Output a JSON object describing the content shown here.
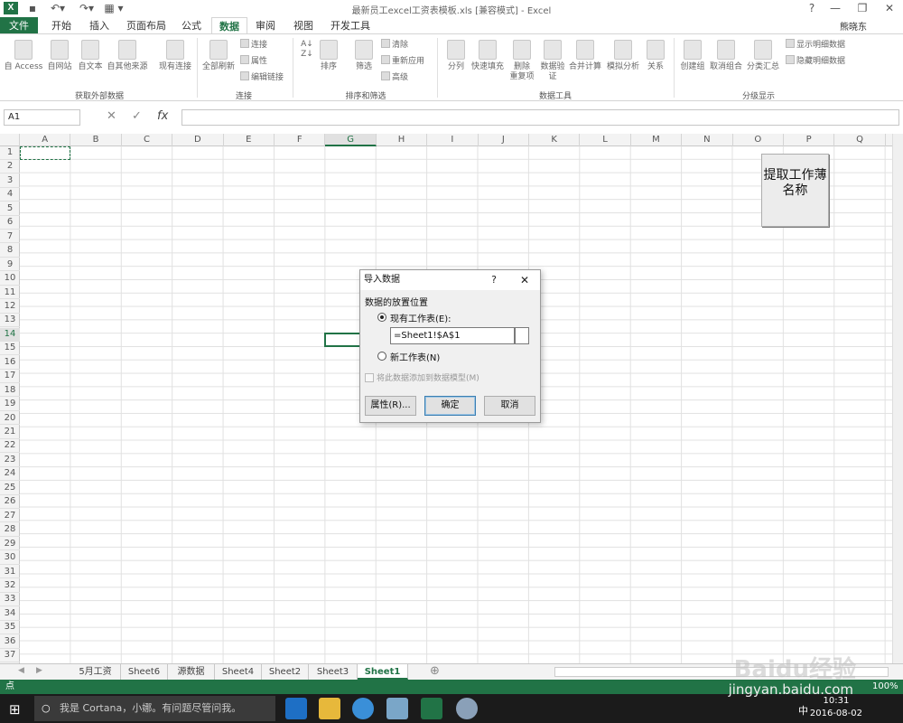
{
  "titlebar": {
    "app_icon": "X",
    "doc_title": "最新员工excel工资表模板.xls  [兼容模式] - Excel",
    "help": "?",
    "minimize": "—",
    "restore": "❐",
    "close": "✕"
  },
  "tabs": [
    {
      "label": "文件"
    },
    {
      "label": "开始"
    },
    {
      "label": "插入"
    },
    {
      "label": "页面布局"
    },
    {
      "label": "公式"
    },
    {
      "label": "数据"
    },
    {
      "label": "审阅"
    },
    {
      "label": "视图"
    },
    {
      "label": "开发工具"
    }
  ],
  "user": "熊晓东",
  "ribbon": {
    "groups": {
      "external": "获取外部数据",
      "connections": "连接",
      "sort_filter": "排序和筛选",
      "data_tools": "数据工具",
      "outline": "分级显示"
    },
    "external": {
      "access": "自 Access",
      "web": "自网站",
      "text": "自文本",
      "other": "自其他来源",
      "existing": "现有连接"
    },
    "connections": {
      "refresh_all": "全部刷新",
      "connect": "连接",
      "props": "属性",
      "edit_links": "编辑链接"
    },
    "sort": {
      "sort": "排序",
      "filter": "筛选",
      "clear": "清除",
      "reapply": "重新应用",
      "advanced": "高级"
    },
    "tools": {
      "split": "分列",
      "flash": "快速填充",
      "dups": "删除\n重复项",
      "validate": "数据验\n证",
      "consolidate": "合并计算",
      "whatif": "模拟分析",
      "relations": "关系"
    },
    "outline": {
      "group": "创建组",
      "ungroup": "取消组合",
      "subtotal": "分类汇总",
      "show": "显示明细数据",
      "hide": "隐藏明细数据"
    }
  },
  "formula_bar": {
    "name_box": "A1",
    "fx": "fx",
    "cancel": "✕",
    "enter": "✓",
    "value": ""
  },
  "columns": [
    "A",
    "B",
    "C",
    "D",
    "E",
    "F",
    "G",
    "H",
    "I",
    "J",
    "K",
    "L",
    "M",
    "N",
    "O",
    "P",
    "Q"
  ],
  "selected_column": "G",
  "rows": [
    "1",
    "2",
    "3",
    "4",
    "5",
    "6",
    "7",
    "8",
    "9",
    "10",
    "11",
    "12",
    "13",
    "14",
    "15",
    "16",
    "17",
    "18",
    "19",
    "20",
    "21",
    "22",
    "23",
    "24",
    "25",
    "26",
    "27",
    "28",
    "29",
    "30",
    "31",
    "32",
    "33",
    "34",
    "35",
    "36",
    "37"
  ],
  "selected_row": "14",
  "macro_button": {
    "line1": "提取工作薄",
    "line2": "名称"
  },
  "sheets": [
    "5月工资",
    "Sheet6",
    "源数据",
    "Sheet4",
    "Sheet2",
    "Sheet3",
    "Sheet1"
  ],
  "active_sheet": "Sheet1",
  "status": {
    "mode": "点",
    "zoom": "100%"
  },
  "dialog": {
    "title": "导入数据",
    "help": "?",
    "close": "✕",
    "section": "数据的放置位置",
    "existing_sheet": "现有工作表(E):",
    "location": "=Sheet1!$A$1",
    "new_sheet": "新工作表(N)",
    "data_model": "将此数据添加到数据模型(M)",
    "properties_btn": "属性(R)...",
    "ok_btn": "确定",
    "cancel_btn": "取消"
  },
  "taskbar": {
    "cortana": "我是 Cortana，小娜。有问题尽管问我。",
    "time": "10:31",
    "date": "2016-08-02",
    "ime": "中"
  },
  "watermark": {
    "main": "Baidu经验",
    "sub": "jingyan.baidu.com"
  }
}
